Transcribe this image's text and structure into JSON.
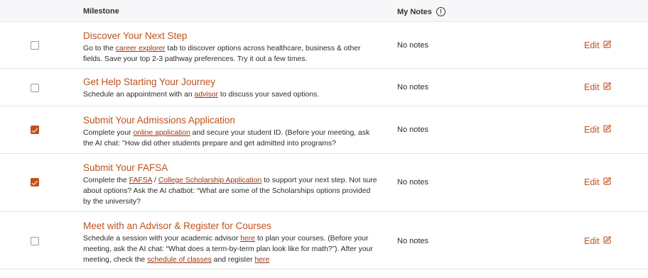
{
  "header": {
    "milestone": "Milestone",
    "my_notes": "My Notes",
    "info_icon": "info-circle-icon"
  },
  "accent_color": "#c0511c",
  "rows": [
    {
      "checked": false,
      "title": "Discover Your Next Step",
      "desc": [
        {
          "t": "Go to the "
        },
        {
          "t": "career explorer",
          "link": true
        },
        {
          "t": " tab to discover options across healthcare, business & other fields. Save your top 2-3 pathway preferences. Try it out a few times."
        }
      ],
      "notes": "No notes",
      "edit": "Edit"
    },
    {
      "checked": false,
      "title": "Get Help Starting Your Journey",
      "desc": [
        {
          "t": "Schedule an appointment with an "
        },
        {
          "t": "advisor",
          "link": true
        },
        {
          "t": " to discuss your saved options."
        }
      ],
      "notes": "No notes",
      "edit": "Edit"
    },
    {
      "checked": true,
      "title": "Submit Your Admissions Application",
      "desc": [
        {
          "t": "Complete your "
        },
        {
          "t": "online application",
          "link": true
        },
        {
          "t": " and secure your student ID. (Before your meeting, ask the AI chat: \"How did other students prepare and get admitted into programs?"
        }
      ],
      "notes": "No notes",
      "edit": "Edit"
    },
    {
      "checked": true,
      "title": "Submit Your FAFSA",
      "desc": [
        {
          "t": "Complete the "
        },
        {
          "t": "FAFSA",
          "link": true
        },
        {
          "t": " / "
        },
        {
          "t": "College Scholarship Application",
          "link": true
        },
        {
          "t": " to support your next step. Not sure about options? Ask the AI chatbot: “What are some of the Scholarships options provided by the university?"
        }
      ],
      "notes": "No notes",
      "edit": "Edit"
    },
    {
      "checked": false,
      "title": "Meet with an Advisor & Register for Courses",
      "desc": [
        {
          "t": "Schedule a session with your academic advisor "
        },
        {
          "t": "here",
          "link": true
        },
        {
          "t": " to plan your courses. (Before your meeting, ask the AI chat: “What does a term-by-term plan look like for math?”). After your meeting, check the "
        },
        {
          "t": "schedule of classes",
          "link": true
        },
        {
          "t": " and register "
        },
        {
          "t": "here",
          "link": true
        }
      ],
      "notes": "No notes",
      "edit": "Edit"
    }
  ]
}
